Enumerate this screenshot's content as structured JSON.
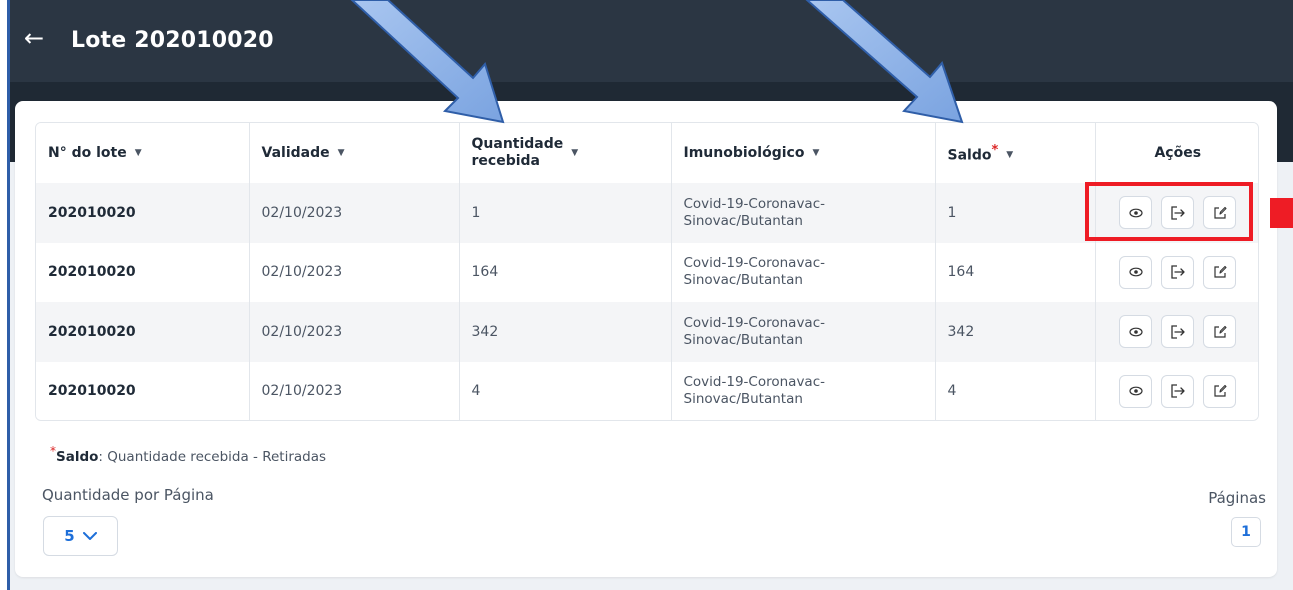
{
  "header": {
    "back_icon": "arrow-left-icon",
    "title": "Lote 202010020"
  },
  "table": {
    "columns": [
      {
        "label": "N° do lote",
        "sortable": true
      },
      {
        "label": "Validade",
        "sortable": true
      },
      {
        "label": "Quantidade recebida",
        "sortable": true
      },
      {
        "label": "Imunobiológico",
        "sortable": true
      },
      {
        "label": "Saldo",
        "sortable": true,
        "required_mark": "*"
      },
      {
        "label": "Ações",
        "sortable": false
      }
    ],
    "rows": [
      {
        "lote": "202010020",
        "validade": "02/10/2023",
        "quantidade": "1",
        "imunobiologico": "Covid-19-Coronavac-Sinovac/Butantan",
        "saldo": "1"
      },
      {
        "lote": "202010020",
        "validade": "02/10/2023",
        "quantidade": "164",
        "imunobiologico": "Covid-19-Coronavac-Sinovac/Butantan",
        "saldo": "164"
      },
      {
        "lote": "202010020",
        "validade": "02/10/2023",
        "quantidade": "342",
        "imunobiologico": "Covid-19-Coronavac-Sinovac/Butantan",
        "saldo": "342"
      },
      {
        "lote": "202010020",
        "validade": "02/10/2023",
        "quantidade": "4",
        "imunobiologico": "Covid-19-Coronavac-Sinovac/Butantan",
        "saldo": "4"
      }
    ],
    "row_actions": [
      "eye-icon",
      "exit-arrow-icon",
      "edit-icon"
    ]
  },
  "note": {
    "mark": "*",
    "term": "Saldo",
    "text": ": Quantidade recebida - Retiradas"
  },
  "pagination": {
    "per_page_label": "Quantidade por Página",
    "per_page_value": "5",
    "pages_label": "Páginas",
    "current_page": "1"
  },
  "colors": {
    "topbar": "#2b3643",
    "subbar": "#1f2934",
    "accent_blue": "#1e6fd9",
    "annotation_red": "#ee1c25",
    "annotation_arrow": "#8fb3e8"
  }
}
